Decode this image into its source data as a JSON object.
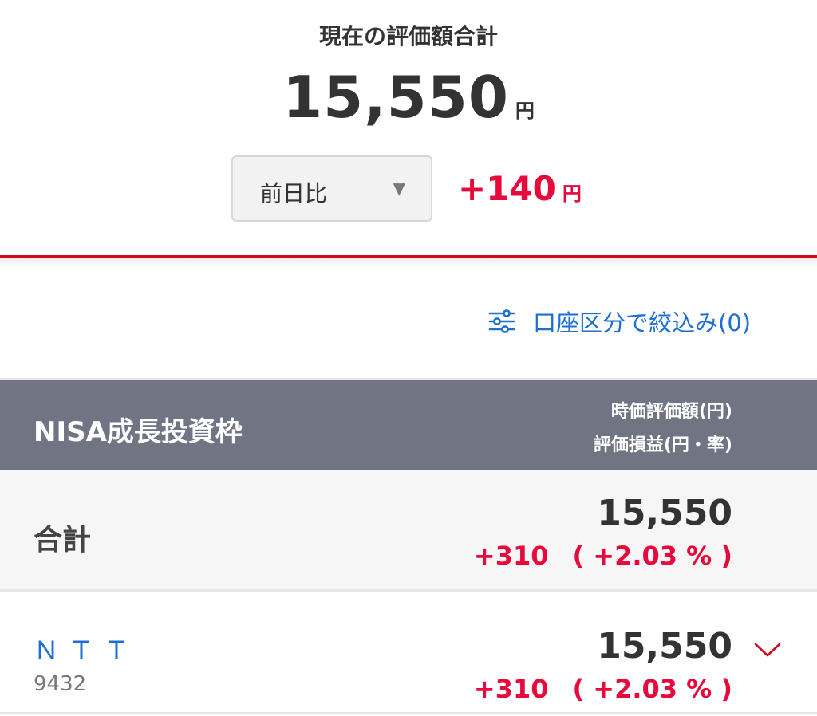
{
  "summary": {
    "title": "現在の評価額合計",
    "total_value": "15,550",
    "total_unit": "円",
    "compare_select": {
      "label": "前日比",
      "caret": "▼"
    },
    "change_value": "+140",
    "change_unit": "円"
  },
  "filter": {
    "label": "口座区分で絞込み(0)",
    "icon": "filter-sliders-icon"
  },
  "section": {
    "title": "NISA成長投資枠",
    "column_head_1": "時価評価額(円)",
    "column_head_2": "評価損益(円・率)"
  },
  "total_row": {
    "label": "合計",
    "value": "15,550",
    "gain": "+310",
    "gain_rate": "( +2.03 % )"
  },
  "holdings": [
    {
      "name": "ＮＴＴ",
      "code": "9432",
      "value": "15,550",
      "gain": "+310",
      "gain_rate": "( +2.03 % )",
      "expand_icon": "chevron-down-icon"
    }
  ],
  "colors": {
    "accent_red": "#e8093c",
    "divider_red": "#cf0a1d",
    "link_blue": "#1d6fd1",
    "header_gray": "#707483"
  }
}
